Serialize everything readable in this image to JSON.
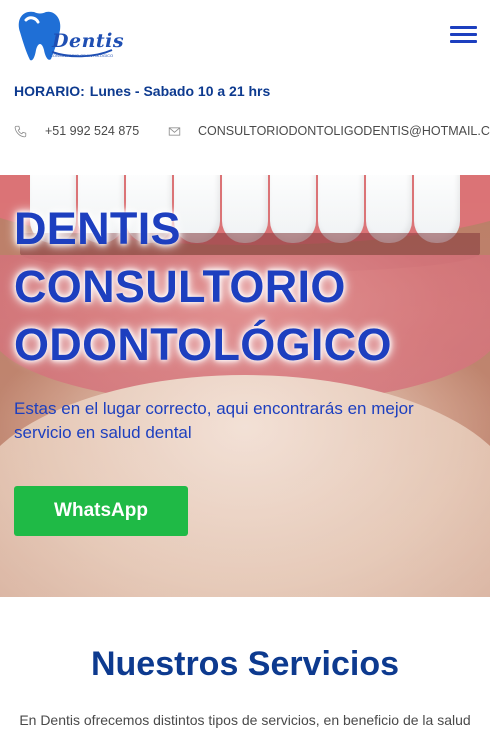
{
  "header": {
    "logo": {
      "text": "Dentis",
      "tagline": "CONSULTORIO ODONTOLÓGICO",
      "icon": "tooth-logo-icon",
      "brand_color": "#1f4fb3"
    },
    "menu_icon": "hamburger-menu-icon",
    "schedule": {
      "label": "HORARIO:",
      "value": "Lunes - Sabado 10 a 21 hrs"
    },
    "contact": {
      "phone_icon": "phone-icon",
      "phone": "+51 992 524 875",
      "email_icon": "mail-icon",
      "email": "CONSULTORIODONTOLIGODENTIS@HOTMAIL.COM"
    }
  },
  "hero": {
    "title_lines": [
      "DENTIS",
      "CONSULTORIO",
      "ODONTOLÓGICO"
    ],
    "subtitle": "Estas en el lugar correcto, aqui encontrarás en mejor servicio en salud dental",
    "button_label": "WhatsApp",
    "button_color": "#1fba46",
    "accent_color": "#1d3fbf"
  },
  "services": {
    "title": "Nuestros Servicios",
    "intro": "En Dentis ofrecemos distintos tipos de servicios, en beneficio de la salud"
  }
}
